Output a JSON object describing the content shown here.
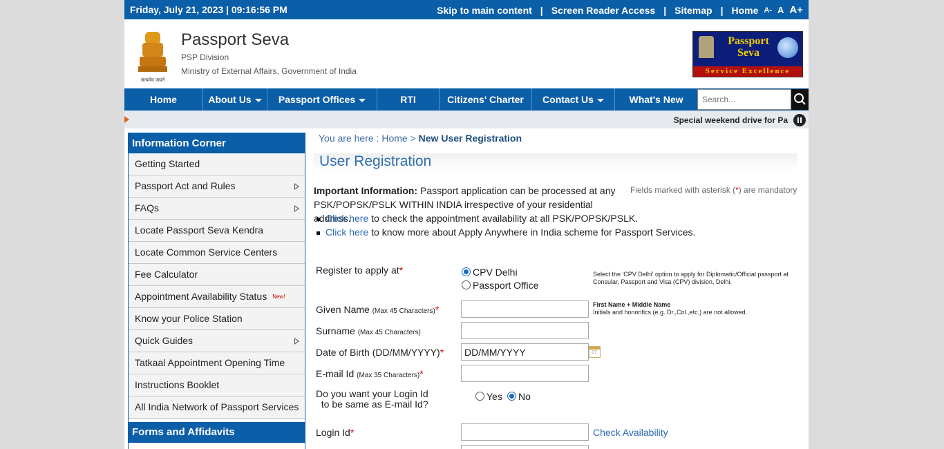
{
  "topbar": {
    "date": "Friday,  July  21, 2023 | 09:16:56 PM",
    "skip": "Skip to main content",
    "reader": "Screen Reader Access",
    "sitemap": "Sitemap",
    "home": "Home",
    "font_small": "A-",
    "font_normal": "A",
    "font_large": "A+"
  },
  "header": {
    "title": "Passport Seva",
    "division": "PSP Division",
    "ministry": "Ministry of External Affairs, Government of India",
    "emblem_caption": "सत्यमेव जयते",
    "logo_line1": "Passport",
    "logo_line2": "Seva",
    "logo_band": "Service Excellence"
  },
  "nav": {
    "items": [
      "Home",
      "About Us",
      "Passport Offices",
      "RTI",
      "Citizens' Charter",
      "Contact Us",
      "What's New"
    ],
    "search_placeholder": "Search..."
  },
  "ticker": {
    "text": "Special weekend drive for Pa"
  },
  "sidebar": {
    "heading": "Information Corner",
    "items": [
      "Getting Started",
      "Passport Act and Rules",
      "FAQs",
      "Locate Passport Seva Kendra",
      "Locate Common Service Centers",
      "Fee Calculator",
      "Appointment Availability Status",
      "Know your Police Station",
      "Quick Guides",
      "Tatkaal Appointment Opening Time",
      "Instructions Booklet",
      "All India Network of Passport Services"
    ],
    "new_badge": "New!",
    "heading2": "Forms and Affidavits"
  },
  "breadcrumb": {
    "prefix": "You are here : ",
    "home": "Home",
    "sep": " > ",
    "current": "New User Registration"
  },
  "page_title": "User Registration",
  "info": {
    "bold": "Important Information:",
    "text": " Passport application can be processed at any PSK/POPSK/PSLK WITHIN INDIA irrespective of your residential address.",
    "mandatory_pre": "Fields marked with asterisk (",
    "mandatory_star": "*",
    "mandatory_post": ") are mandatory",
    "bullet1_link": "Click here",
    "bullet1_text": " to check the appointment availability at all PSK/POPSK/PSLK.",
    "bullet2_link": "Click here",
    "bullet2_text": " to know more about Apply Anywhere in India scheme for Passport Services."
  },
  "form": {
    "register_label": "Register to apply at",
    "opt_cpv": "CPV Delhi",
    "opt_office": "Passport Office",
    "cpv_note": "Select the 'CPV Delhi' option to apply for Diplomatic/Official passport at Consular, Passport and Visa (CPV) division, Delhi.",
    "given_label": "Given Name",
    "given_hint": "(Max 45 Characters)",
    "given_note_bold": "First Name + Middle Name",
    "given_note": "Initials and honorifics (e.g. Dr.,Col.,etc.) are not allowed.",
    "surname_label": "Surname",
    "surname_hint": "(Max 45 Characters)",
    "dob_label": "Date of Birth (DD/MM/YYYY)",
    "dob_value": "DD/MM/YYYY",
    "email_label": "E-mail Id",
    "email_hint": "(Max 35 Characters)",
    "same_q1": "Do you want your Login Id",
    "same_q2": "to be same as E-mail Id?",
    "yes": "Yes",
    "no": "No",
    "login_label": "Login Id",
    "check": "Check Availability",
    "star": "*"
  }
}
